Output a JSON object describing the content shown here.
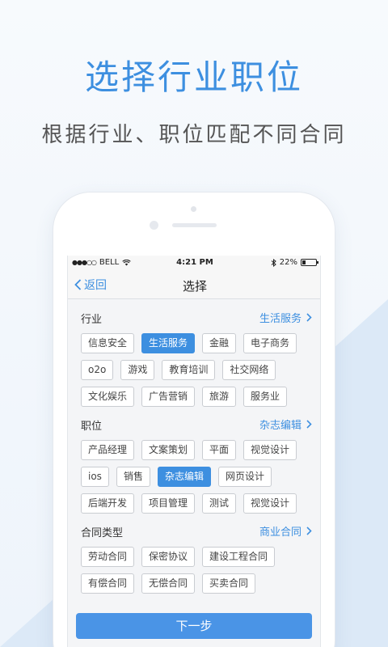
{
  "headline": "选择行业职位",
  "subline": "根据行业、职位匹配不同合同",
  "status_bar": {
    "carrier": "BELL",
    "time": "4:21 PM",
    "battery": "22%",
    "battery_level": 0.22
  },
  "nav": {
    "back_label": "返回",
    "title": "选择"
  },
  "sections": {
    "industry": {
      "title": "行业",
      "selected_value": "生活服务",
      "rows": [
        [
          "信息安全",
          "生活服务",
          "金融",
          "电子商务"
        ],
        [
          "o2o",
          "游戏",
          "教育培训",
          "社交网络"
        ],
        [
          "文化娱乐",
          "广告营销",
          "旅游",
          "服务业"
        ]
      ]
    },
    "position": {
      "title": "职位",
      "selected_value": "杂志编辑",
      "rows": [
        [
          "产品经理",
          "文案策划",
          "平面",
          "视觉设计"
        ],
        [
          "ios",
          "销售",
          "杂志编辑",
          "网页设计"
        ],
        [
          "后端开发",
          "项目管理",
          "测试",
          "视觉设计"
        ]
      ]
    },
    "contract": {
      "title": "合同类型",
      "selected_value": "商业合同",
      "rows": [
        [
          "劳动合同",
          "保密协议",
          "建设工程合同"
        ],
        [
          "有偿合同",
          "无偿合同",
          "买卖合同"
        ]
      ]
    }
  },
  "next_button": "下一步",
  "colors": {
    "accent": "#3d8fe0",
    "button": "#4a94e6"
  }
}
